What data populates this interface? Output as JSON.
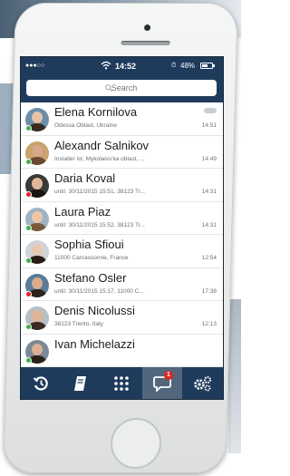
{
  "status_bar": {
    "signal": "●●●○○",
    "time": "14:52",
    "battery_percent": "48%"
  },
  "search": {
    "placeholder": "Search"
  },
  "contacts": [
    {
      "name": "Elena Kornilova",
      "subtitle": "Odessa Oblast, Ukraine",
      "time": "14:51",
      "presence_color": "#3cb24a",
      "avatar_bg": "#6b8faa",
      "skin": "#e8c2a4",
      "hair": "#3a2a22"
    },
    {
      "name": "Alexandr Salnikov",
      "subtitle": "Installer ist, Mykolaivs'ka oblast, ...",
      "time": "14:49",
      "presence_color": "#3cb24a",
      "avatar_bg": "#caa36f",
      "skin": "#d9a88a",
      "hair": "#6a4a32"
    },
    {
      "name": "Daria Koval",
      "subtitle": "until: 30/11/2015 15:51, 38123 Tr...",
      "time": "14:31",
      "presence_color": "#e0231f",
      "avatar_bg": "#3a3a3a",
      "skin": "#e3b898",
      "hair": "#1a1410"
    },
    {
      "name": "Laura Piaz",
      "subtitle": "until: 30/11/2015 15:52, 38123 Tr...",
      "time": "14:31",
      "presence_color": "#3cb24a",
      "avatar_bg": "#9fb3c3",
      "skin": "#ecc6aa",
      "hair": "#7a5a3a"
    },
    {
      "name": "Sophia Sfioui",
      "subtitle": "11000 Carcassonne, France",
      "time": "12:54",
      "presence_color": "#3cb24a",
      "avatar_bg": "#d0d4d8",
      "skin": "#eac8ad",
      "hair": "#2a1c14"
    },
    {
      "name": "Stefano Osler",
      "subtitle": "until: 30/11/2015 15:17, 11000 C...",
      "time": "17:38",
      "presence_color": "#e0231f",
      "avatar_bg": "#5a7c98",
      "skin": "#d9ac8e",
      "hair": "#2e221a"
    },
    {
      "name": "Denis Nicolussi",
      "subtitle": "38123 Trento, Italy",
      "time": "12:13",
      "presence_color": "#3cb24a",
      "avatar_bg": "#b8bec4",
      "skin": "#e0b496",
      "hair": "#3a2a20"
    },
    {
      "name": "Ivan Michelazzi",
      "subtitle": "",
      "time": "",
      "presence_color": "#3cb24a",
      "avatar_bg": "#7a8a96",
      "skin": "#dcb092",
      "hair": "#2a2018"
    }
  ],
  "tabs": [
    {
      "icon": "history-icon"
    },
    {
      "icon": "phonebook-icon"
    },
    {
      "icon": "keypad-icon"
    },
    {
      "icon": "chat-icon",
      "badge": "1",
      "active": true
    },
    {
      "icon": "settings-icon"
    }
  ],
  "colors": {
    "nav_bar": "#1f3b5c",
    "active_tab": "#52677c",
    "badge": "#e0231f",
    "online": "#3cb24a",
    "busy": "#e0231f"
  }
}
